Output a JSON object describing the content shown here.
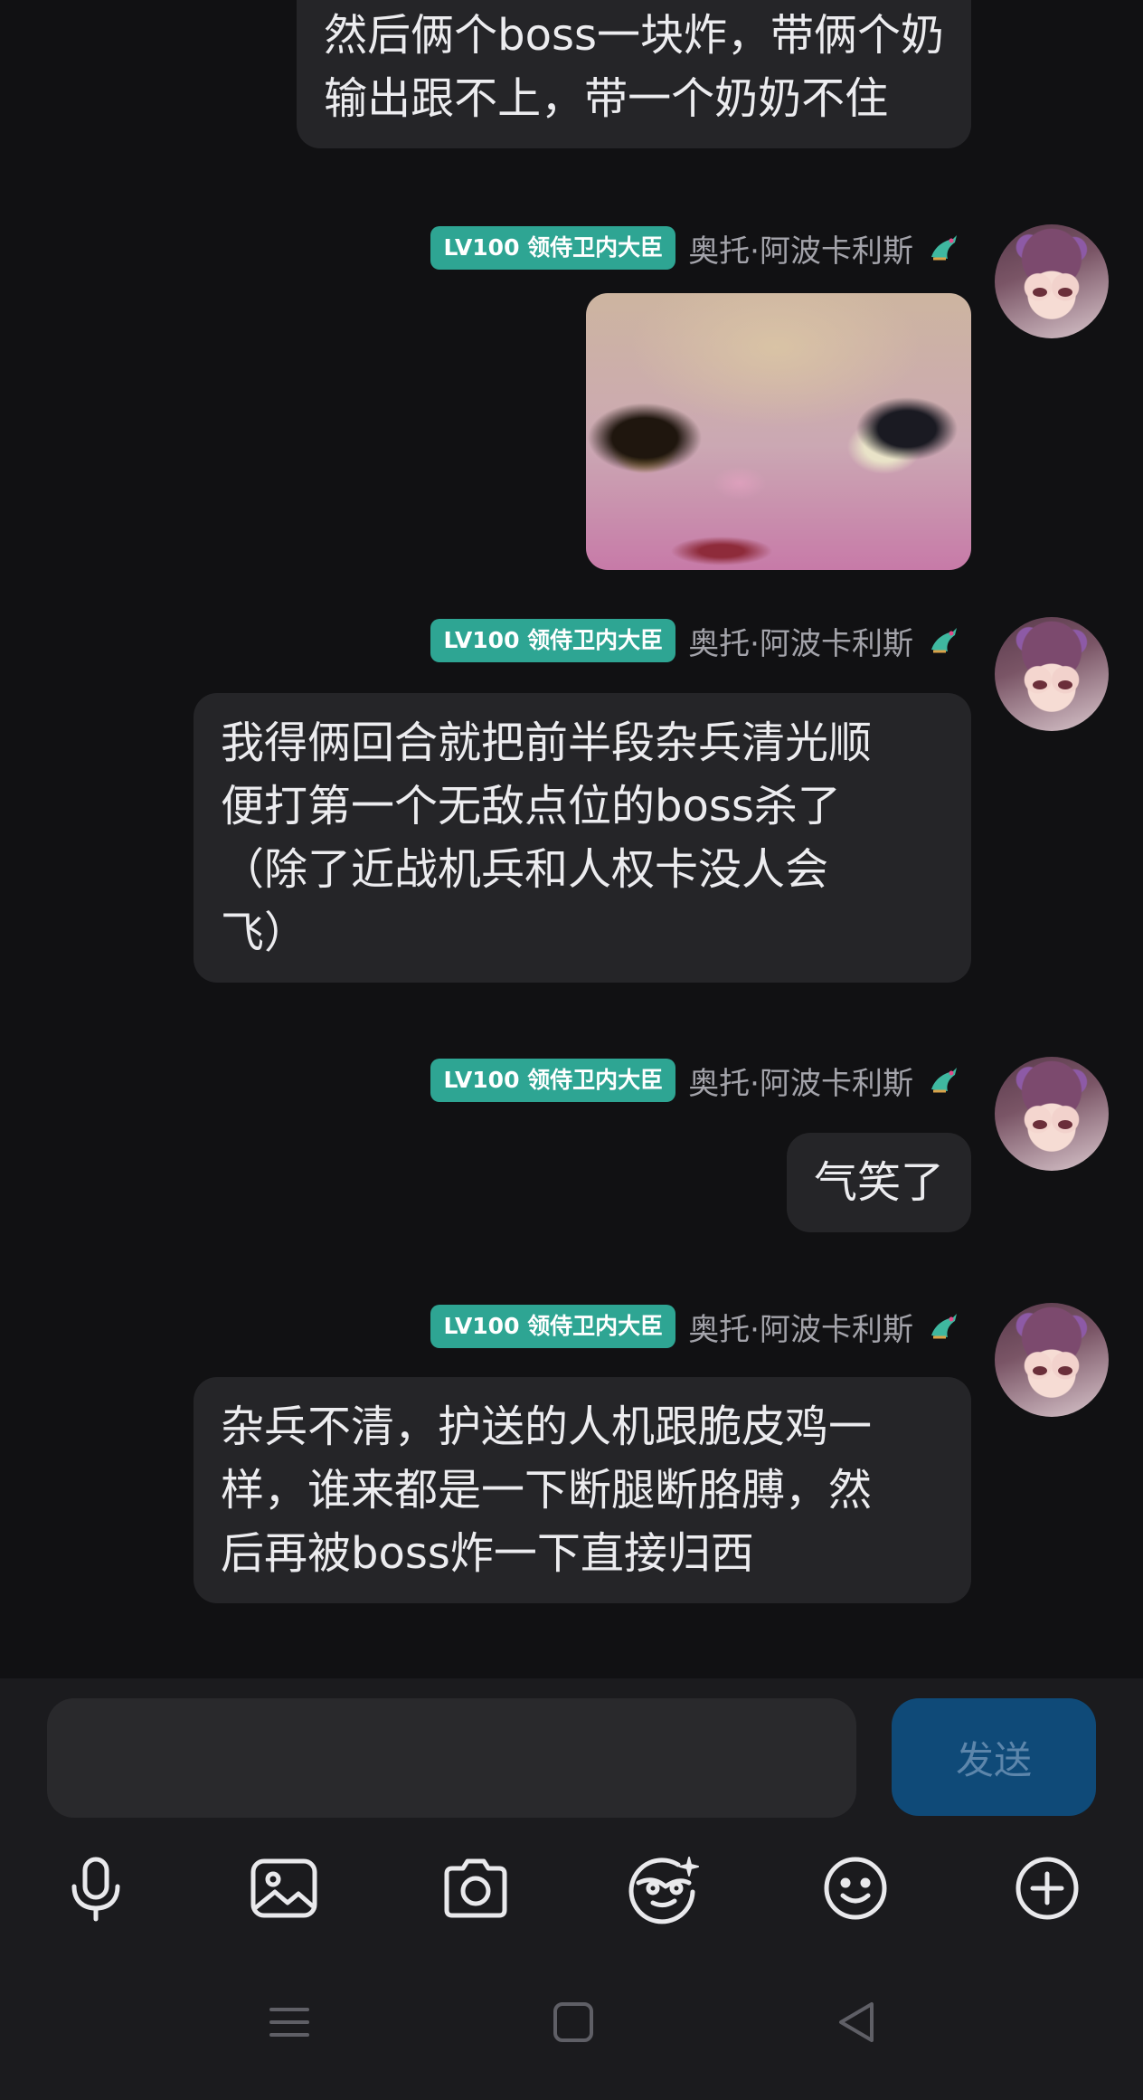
{
  "messages": [
    {
      "type": "text",
      "text": "然后俩个boss一块炸，带俩个奶\n输出跟不上，带一个奶奶不住"
    },
    {
      "type": "image",
      "level_badge": "LV100 领侍卫内大臣",
      "username": "奥托·阿波卡利斯"
    },
    {
      "type": "text",
      "level_badge": "LV100 领侍卫内大臣",
      "username": "奥托·阿波卡利斯",
      "text": "我得俩回合就把前半段杂兵清光顺\n便打第一个无敌点位的boss杀了\n（除了近战机兵和人权卡没人会\n飞）"
    },
    {
      "type": "text",
      "level_badge": "LV100 领侍卫内大臣",
      "username": "奥托·阿波卡利斯",
      "text": "气笑了"
    },
    {
      "type": "text",
      "level_badge": "LV100 领侍卫内大臣",
      "username": "奥托·阿波卡利斯",
      "text": "杂兵不清，护送的人机跟脆皮鸡一\n样，谁来都是一下断腿断胳膊，然\n后再被boss炸一下直接归西"
    }
  ],
  "composer": {
    "input_value": "",
    "send_label": "发送"
  },
  "toolbar": {
    "icons": [
      "microphone-icon",
      "image-icon",
      "camera-icon",
      "sticker-icon",
      "emoji-icon",
      "plus-icon"
    ]
  },
  "nav_bar": {
    "icons": [
      "menu-icon",
      "home-icon",
      "back-icon"
    ]
  },
  "colors": {
    "background": "#111113",
    "bubble": "#252528",
    "badge": "#2ea593",
    "send_button": "#0f4a78"
  }
}
